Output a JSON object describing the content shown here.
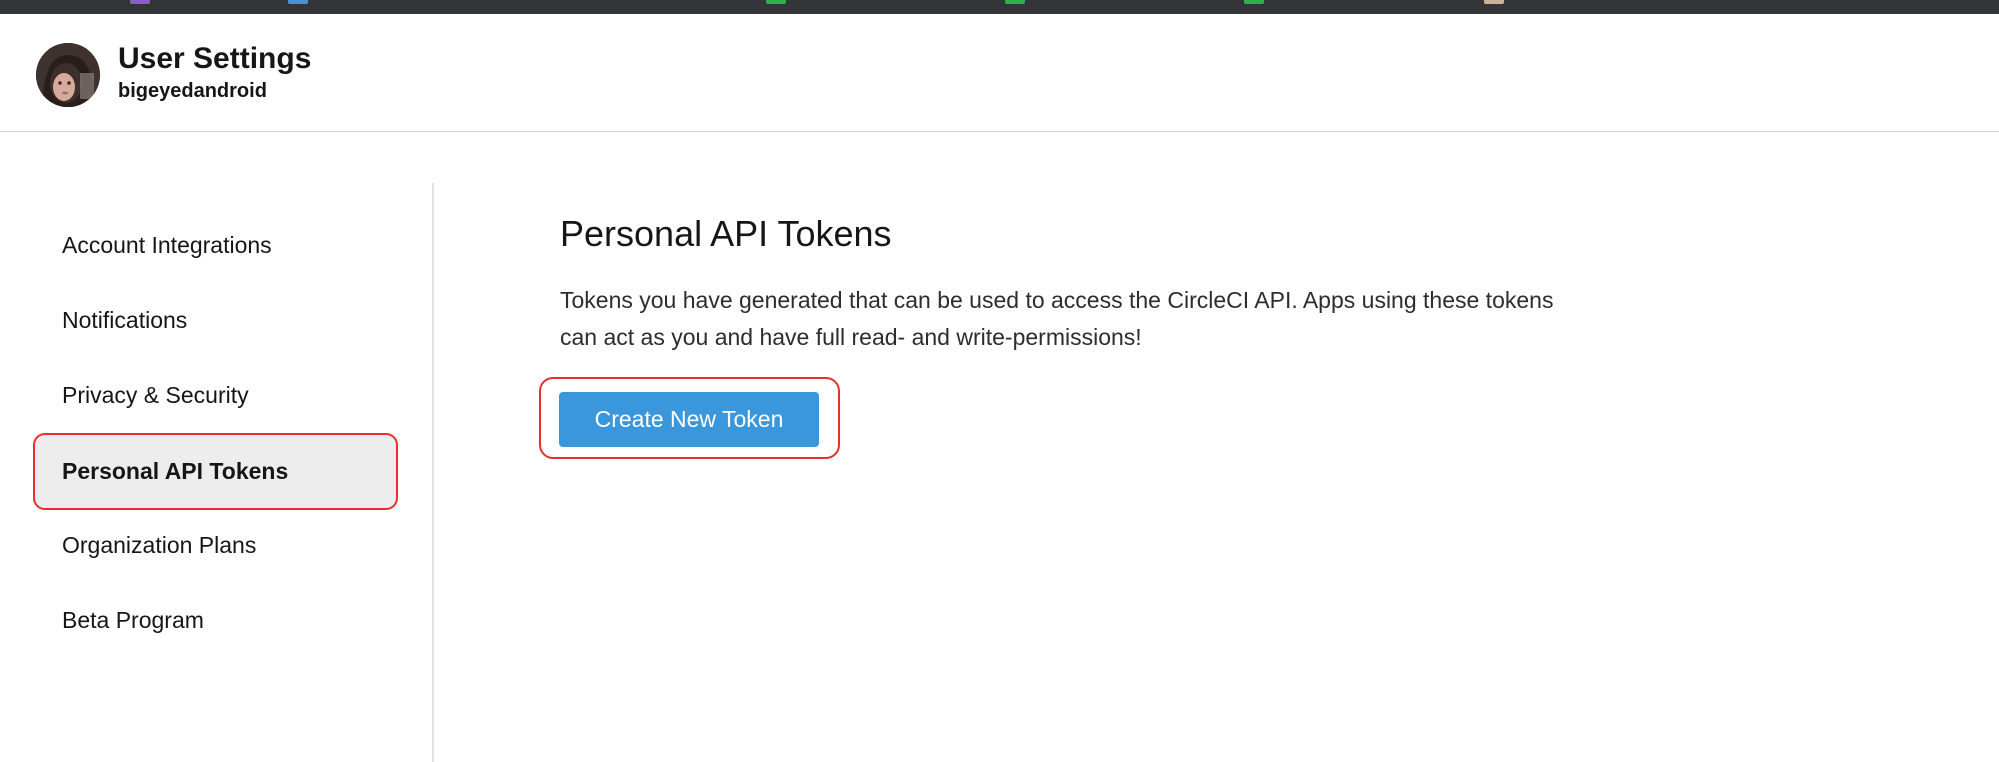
{
  "header": {
    "title": "User Settings",
    "username": "bigeyedandroid"
  },
  "sidebar": {
    "items": [
      {
        "label": "Account Integrations",
        "active": false
      },
      {
        "label": "Notifications",
        "active": false
      },
      {
        "label": "Privacy & Security",
        "active": false
      },
      {
        "label": "Personal API Tokens",
        "active": true
      },
      {
        "label": "Organization Plans",
        "active": false
      },
      {
        "label": "Beta Program",
        "active": false
      }
    ]
  },
  "main": {
    "title": "Personal API Tokens",
    "description": "Tokens you have generated that can be used to access the CircleCI API. Apps using these tokens can act as you and have full read- and write-permissions!",
    "create_button_label": "Create New Token"
  },
  "colors": {
    "accent": "#3b97dc",
    "highlight_outline": "#e8302a",
    "active_background": "#ededed"
  }
}
